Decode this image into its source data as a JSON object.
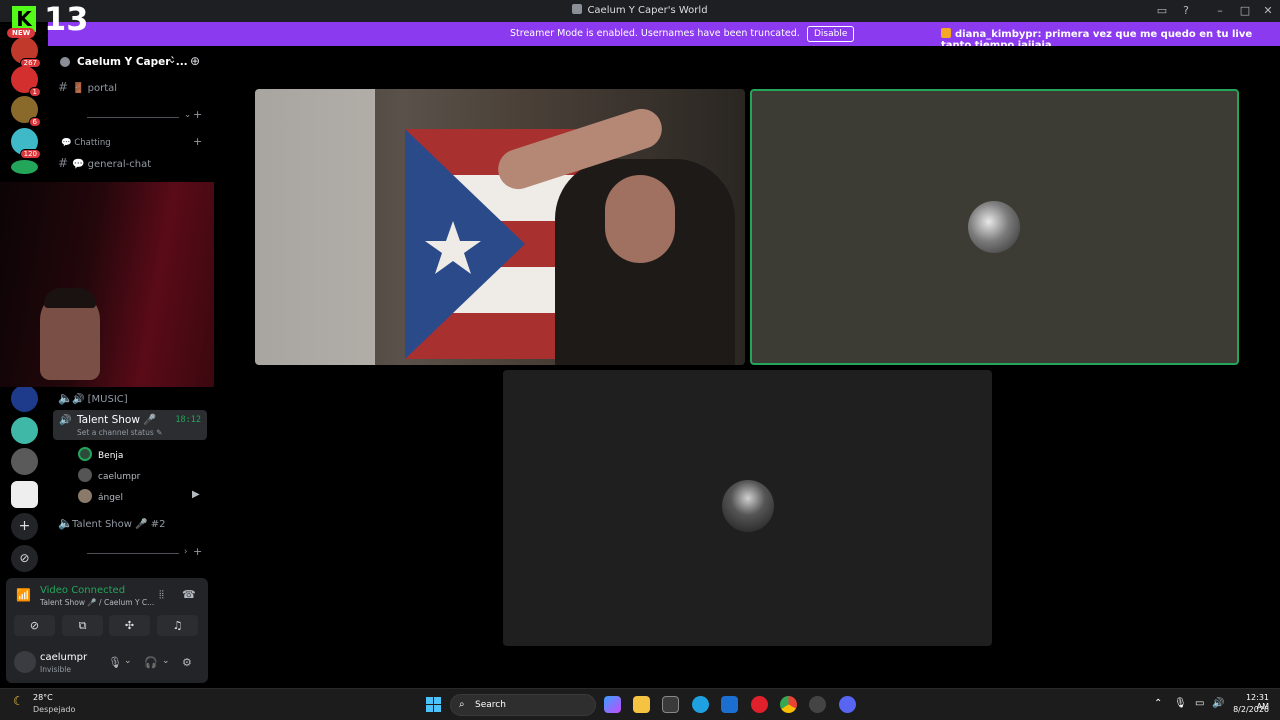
{
  "window": {
    "title": "Caelum Y Caper's World"
  },
  "banner": {
    "message": "Streamer Mode is enabled. Usernames have been truncated.",
    "disable_label": "Disable",
    "chat_user": "diana_kimbypr",
    "chat_message": ": primera vez que me quedo en tu live tanto tiempo jajjaja"
  },
  "overlay": {
    "logo_letter": "K",
    "logo_number": "13",
    "new_label": "NEW"
  },
  "guilds": {
    "badges": [
      "267",
      "1",
      "6",
      "120"
    ]
  },
  "server": {
    "name": "Caelum Y Caper`..."
  },
  "channels": {
    "portal": "🚪 portal",
    "category_chatting": "💬 Chatting",
    "general_chat": "💬 general-chat",
    "music": "🔊 [MUSIC]",
    "talent_show": "Talent Show 🎤",
    "talent_show_time": "18:12",
    "talent_show_status": "Set a channel status ✎",
    "talent_show_2": "Talent Show 🎤 #2"
  },
  "members": [
    "Benja",
    "caelumpr",
    "ángel"
  ],
  "rtc": {
    "status": "Video Connected",
    "location": "Talent Show 🎤 / Caelum Y C...",
    "username": "caelumpr",
    "user_status": "Invisible"
  },
  "taskbar": {
    "temperature": "28°C",
    "condition": "Despejado",
    "search_label": "Search",
    "time": "12:31 AM",
    "date": "8/2/2026"
  }
}
